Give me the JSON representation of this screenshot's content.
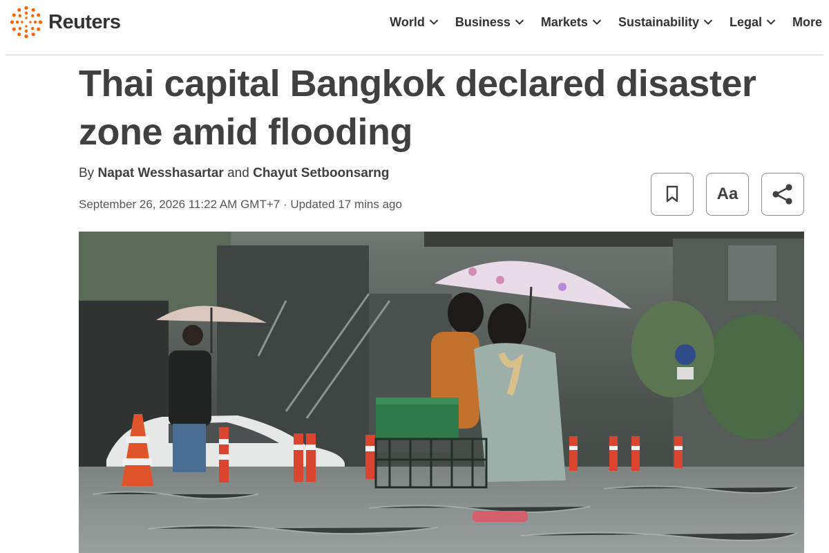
{
  "brand": {
    "name": "Reuters",
    "accent": "#fa6400"
  },
  "nav": {
    "items": [
      {
        "label": "World",
        "has_dropdown": true
      },
      {
        "label": "Business",
        "has_dropdown": true
      },
      {
        "label": "Markets",
        "has_dropdown": true
      },
      {
        "label": "Sustainability",
        "has_dropdown": true
      },
      {
        "label": "Legal",
        "has_dropdown": true
      },
      {
        "label": "More",
        "has_dropdown": false
      }
    ]
  },
  "article": {
    "headline_line1": "Thai capital Bangkok declared disaster",
    "headline_line2": "zone amid flooding",
    "byline": {
      "prefix": "By",
      "author1": "Napat Wesshasartar",
      "conjunction": "and",
      "author2": "Chayut Setboonsarng"
    },
    "dateline": "September 26, 2026 11:22 AM GMT+7 · Updated 17 mins ago",
    "actions": {
      "bookmark_icon": "bookmark-icon",
      "text_size_label": "Aa",
      "share_icon": "share-icon"
    }
  },
  "colors": {
    "text": "#404040",
    "border": "#8a8a8a",
    "rule": "#d0d0d0"
  }
}
